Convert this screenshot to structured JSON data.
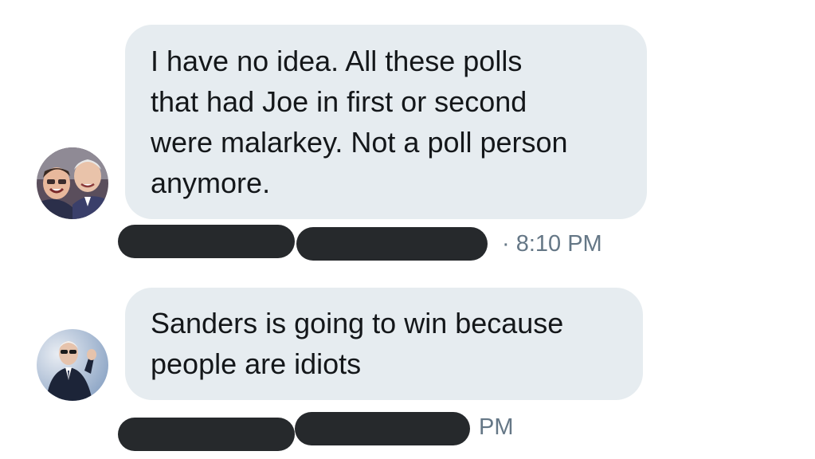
{
  "messages": [
    {
      "avatar": "avatar-two-people-selfie-icon",
      "lines": [
        "I have no idea. All these polls",
        "that had Joe in first or second",
        "were malarkey. Not a poll person",
        "anymore."
      ],
      "time_text": "· 8:10 PM"
    },
    {
      "avatar": "avatar-man-in-suit-icon",
      "lines": [
        "Sanders is going to win because",
        "people are idiots"
      ],
      "time_text": "PM"
    }
  ]
}
